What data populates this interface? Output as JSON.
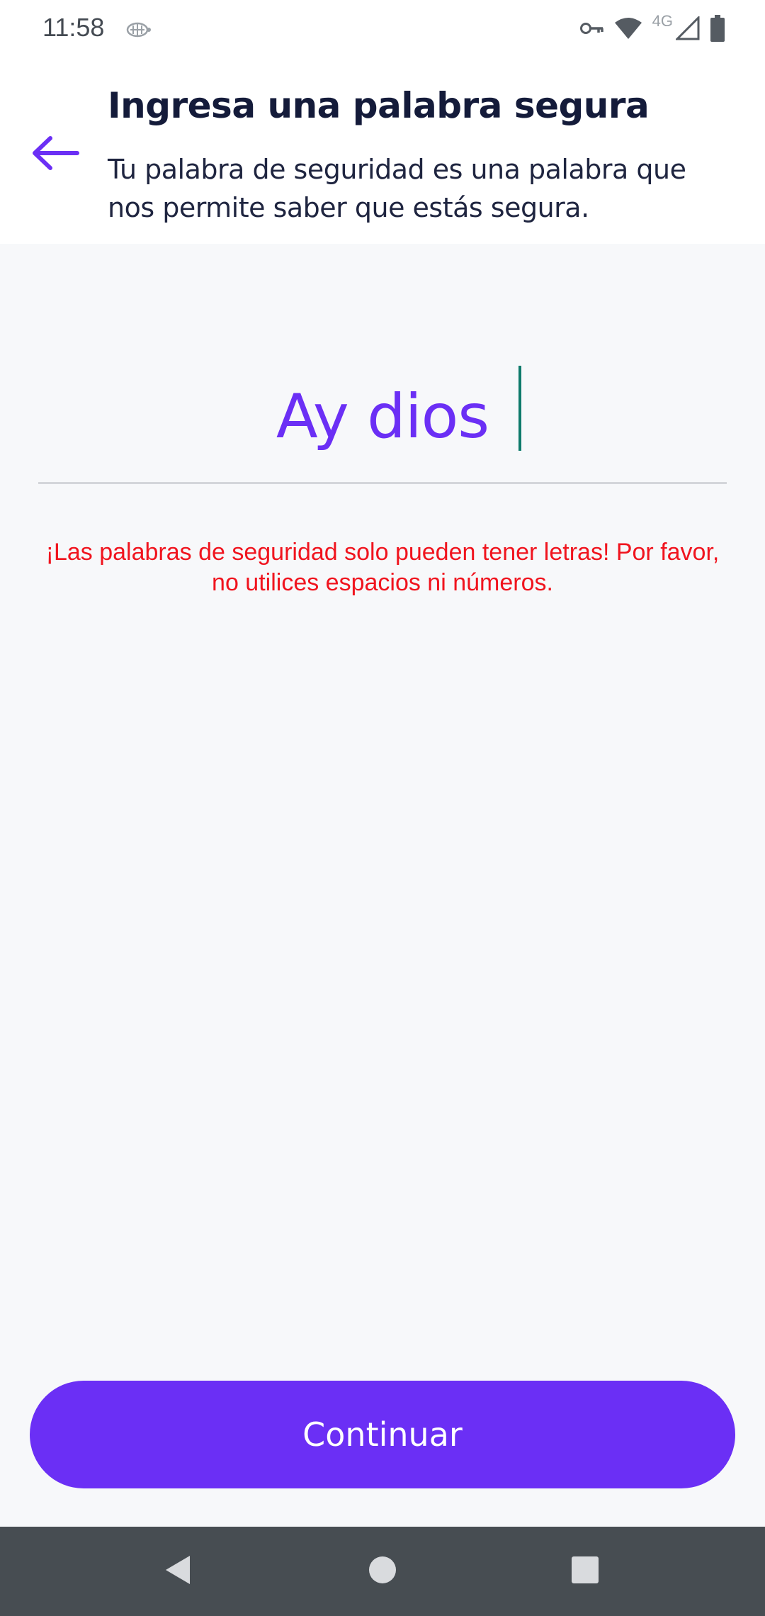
{
  "status_bar": {
    "time": "11:58",
    "network_label": "4G"
  },
  "header": {
    "title": "Ingresa una palabra segura",
    "subtitle": "Tu palabra de seguridad es una palabra que nos permite saber que estás segura."
  },
  "security_word": {
    "value": "Ay dios"
  },
  "error": {
    "message": "¡Las palabras de seguridad solo pueden tener letras! Por favor, no utilices espacios ni números."
  },
  "actions": {
    "continue_label": "Continuar"
  },
  "colors": {
    "accent": "#6b2ff5",
    "error": "#f0141e",
    "title": "#141b3a",
    "background": "#f7f8fa",
    "nav_bar": "#474d52"
  },
  "icons": {
    "back": "arrow-left-icon",
    "key": "key-icon",
    "wifi": "wifi-icon",
    "signal": "signal-icon",
    "battery": "battery-icon",
    "nav_back": "nav-back-icon",
    "nav_home": "nav-home-icon",
    "nav_recents": "nav-recents-icon"
  }
}
